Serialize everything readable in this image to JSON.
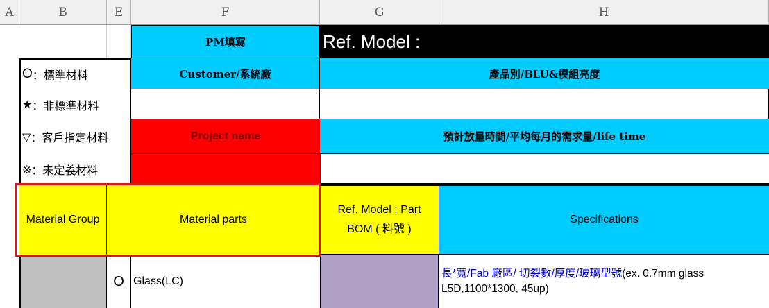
{
  "columns": [
    "A",
    "B",
    "E",
    "F",
    "G",
    "H"
  ],
  "legend": [
    {
      "symbol": "O",
      "text": "：標準材料"
    },
    {
      "symbol": "★",
      "text": "：非標準材料"
    },
    {
      "symbol": "▽",
      "text": "：客戶指定材料"
    },
    {
      "symbol": "※",
      "text": "：未定義材料"
    }
  ],
  "form": {
    "pm_fill": "PM填寫",
    "ref_model": "Ref. Model :",
    "customer": "Customer/系統廠",
    "product_type": "產品別/BLU&模組亮度",
    "project_name": "Project name",
    "schedule": "預計放量時間/平均每月的需求量/life time"
  },
  "table": {
    "headers": {
      "material_group": "Material Group",
      "material_parts": "Material parts",
      "ref_model_bom_line1": "Ref. Model : Part",
      "ref_model_bom_line2": "BOM ( 料號 )",
      "specifications": "Specifications"
    },
    "row1": {
      "symbol": "O",
      "part": "Glass(LC)",
      "spec_cn": "長*寬/Fab 廠區/ 切裂數/厚度/玻璃型號",
      "spec_en": "(ex. 0.7mm glass",
      "spec_line2": "L5D,1100*1300, 45up)"
    }
  },
  "colors": {
    "cyan": "#00ccff",
    "red": "#ff0000",
    "yellow": "#ffff00",
    "highlight_border": "#e0151c",
    "spec_text_blue": "#0000cc"
  }
}
